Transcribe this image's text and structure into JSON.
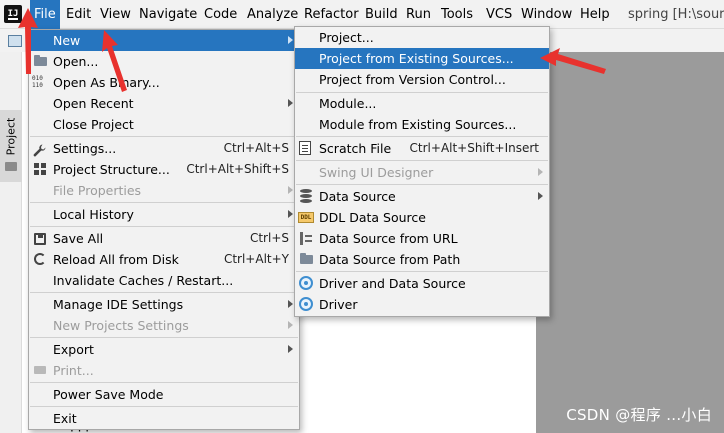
{
  "menubar": {
    "logo": "IJ",
    "menus": [
      "File",
      "Edit",
      "View",
      "Navigate",
      "Code",
      "Analyze",
      "Refactor",
      "Build",
      "Run",
      "Tools",
      "VCS",
      "Window",
      "Help"
    ],
    "window_title": "spring [H:\\sourc"
  },
  "sidebar": {
    "tab_label": "Project"
  },
  "tree": {
    "partial_text": "· · ·"
  },
  "file_menu": {
    "items": [
      {
        "label": "New",
        "shortcut": ""
      },
      {
        "label": "Open...",
        "shortcut": ""
      },
      {
        "label": "Open As Binary...",
        "shortcut": ""
      },
      {
        "label": "Open Recent",
        "shortcut": ""
      },
      {
        "label": "Close Project",
        "shortcut": ""
      },
      {
        "label": "Settings...",
        "shortcut": "Ctrl+Alt+S"
      },
      {
        "label": "Project Structure...",
        "shortcut": "Ctrl+Alt+Shift+S"
      },
      {
        "label": "File Properties",
        "shortcut": ""
      },
      {
        "label": "Local History",
        "shortcut": ""
      },
      {
        "label": "Save All",
        "shortcut": "Ctrl+S"
      },
      {
        "label": "Reload All from Disk",
        "shortcut": "Ctrl+Alt+Y"
      },
      {
        "label": "Invalidate Caches / Restart...",
        "shortcut": ""
      },
      {
        "label": "Manage IDE Settings",
        "shortcut": ""
      },
      {
        "label": "New Projects Settings",
        "shortcut": ""
      },
      {
        "label": "Export",
        "shortcut": ""
      },
      {
        "label": "Print...",
        "shortcut": ""
      },
      {
        "label": "Power Save Mode",
        "shortcut": ""
      },
      {
        "label": "Exit",
        "shortcut": ""
      }
    ]
  },
  "new_menu": {
    "items": [
      {
        "label": "Project...",
        "shortcut": ""
      },
      {
        "label": "Project from Existing Sources...",
        "shortcut": ""
      },
      {
        "label": "Project from Version Control...",
        "shortcut": ""
      },
      {
        "label": "Module...",
        "shortcut": ""
      },
      {
        "label": "Module from Existing Sources...",
        "shortcut": ""
      },
      {
        "label": "Scratch File",
        "shortcut": "Ctrl+Alt+Shift+Insert"
      },
      {
        "label": "Swing UI Designer",
        "shortcut": ""
      },
      {
        "label": "Data Source",
        "shortcut": ""
      },
      {
        "label": "DDL Data Source",
        "shortcut": ""
      },
      {
        "label": "Data Source from URL",
        "shortcut": ""
      },
      {
        "label": "Data Source from Path",
        "shortcut": ""
      },
      {
        "label": "Driver and Data Source",
        "shortcut": ""
      },
      {
        "label": "Driver",
        "shortcut": ""
      }
    ]
  },
  "icons": {
    "ddl_text": "DDL",
    "binary_text": "010\n110"
  },
  "watermark": "CSDN @程序 ...小白",
  "colors": {
    "highlight": "#2675bf",
    "menu_bg": "#f2f2f2",
    "annotation_red": "#e8322e",
    "editor_gray": "#9b9b9b"
  }
}
